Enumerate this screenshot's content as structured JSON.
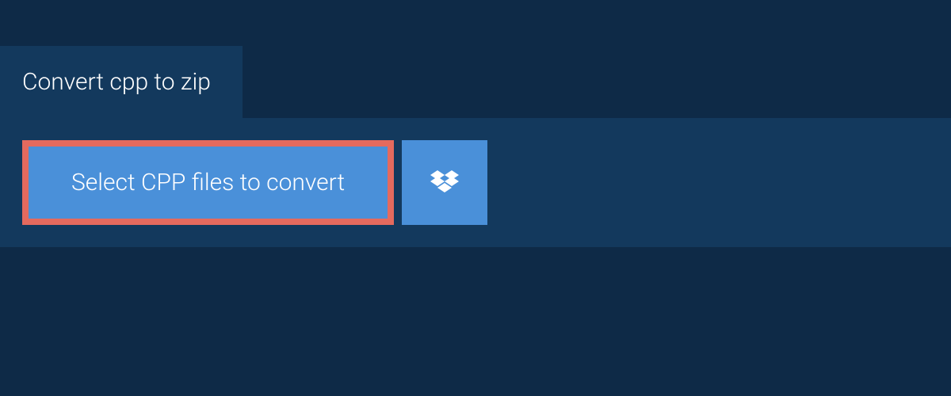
{
  "tab": {
    "label": "Convert cpp to zip"
  },
  "actions": {
    "select_files_label": "Select CPP files to convert"
  },
  "colors": {
    "background": "#0e2a47",
    "panel": "#13395d",
    "button": "#4a90d9",
    "highlight_border": "#e46a5e",
    "text": "#ffffff"
  }
}
